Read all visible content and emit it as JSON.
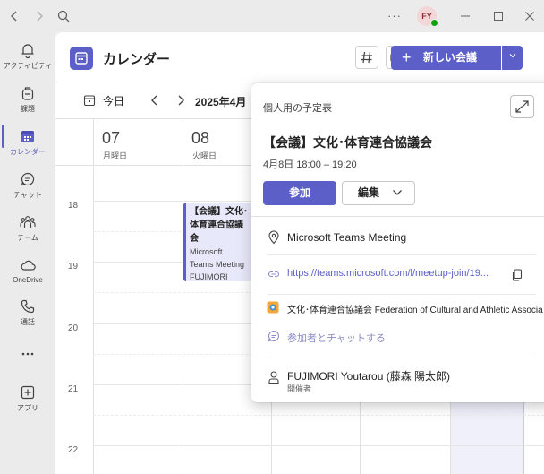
{
  "colors": {
    "accent": "#5b5fc7",
    "presence": "#13a10e",
    "avatar_bg": "#f3d6d8"
  },
  "titlebar": {
    "back_icon": "chevron-left-icon",
    "forward_icon": "chevron-right-icon",
    "search_icon": "search-icon",
    "more_glyph": "···",
    "avatar_initials": "FY"
  },
  "rail": {
    "items": [
      {
        "label": "アクティビティ",
        "icon": "bell-icon"
      },
      {
        "label": "課題",
        "icon": "backpack-icon"
      },
      {
        "label": "カレンダー",
        "icon": "calendar-icon"
      },
      {
        "label": "チャット",
        "icon": "chat-icon"
      },
      {
        "label": "チーム",
        "icon": "teams-icon"
      },
      {
        "label": "OneDrive",
        "icon": "cloud-icon"
      },
      {
        "label": "通話",
        "icon": "phone-icon"
      },
      {
        "label": "",
        "icon": "more-icon"
      },
      {
        "label": "アプリ",
        "icon": "add-apps-icon"
      }
    ]
  },
  "header": {
    "title": "カレンダー",
    "new_meeting_label": "新しい会議"
  },
  "toolbar": {
    "today_label": "今日",
    "range_label": "2025年4月"
  },
  "days": [
    {
      "num": "07",
      "name": "月曜日"
    },
    {
      "num": "08",
      "name": "火曜日"
    }
  ],
  "hours": [
    "18",
    "19",
    "20",
    "21",
    "22"
  ],
  "event": {
    "title": "【会議】文化･体育連合協議会",
    "line1": "Microsoft",
    "line2": "Teams Meeting",
    "line3": "FUJIMORI"
  },
  "popup": {
    "caption": "個人用の予定表",
    "title": "【会議】文化･体育連合協議会",
    "time": "4月8日 18:00 – 19:20",
    "join_label": "参加",
    "edit_label": "編集",
    "location": "Microsoft Teams Meeting",
    "link": "https://teams.microsoft.com/l/meetup-join/19...",
    "channel": "文化･体育連合協議会 Federation of Cultural and Athletic Associa",
    "chat": "参加者とチャットする",
    "organizer_name": "FUJIMORI Youtarou (藤森 陽太郎)",
    "organizer_role": "開催者"
  }
}
